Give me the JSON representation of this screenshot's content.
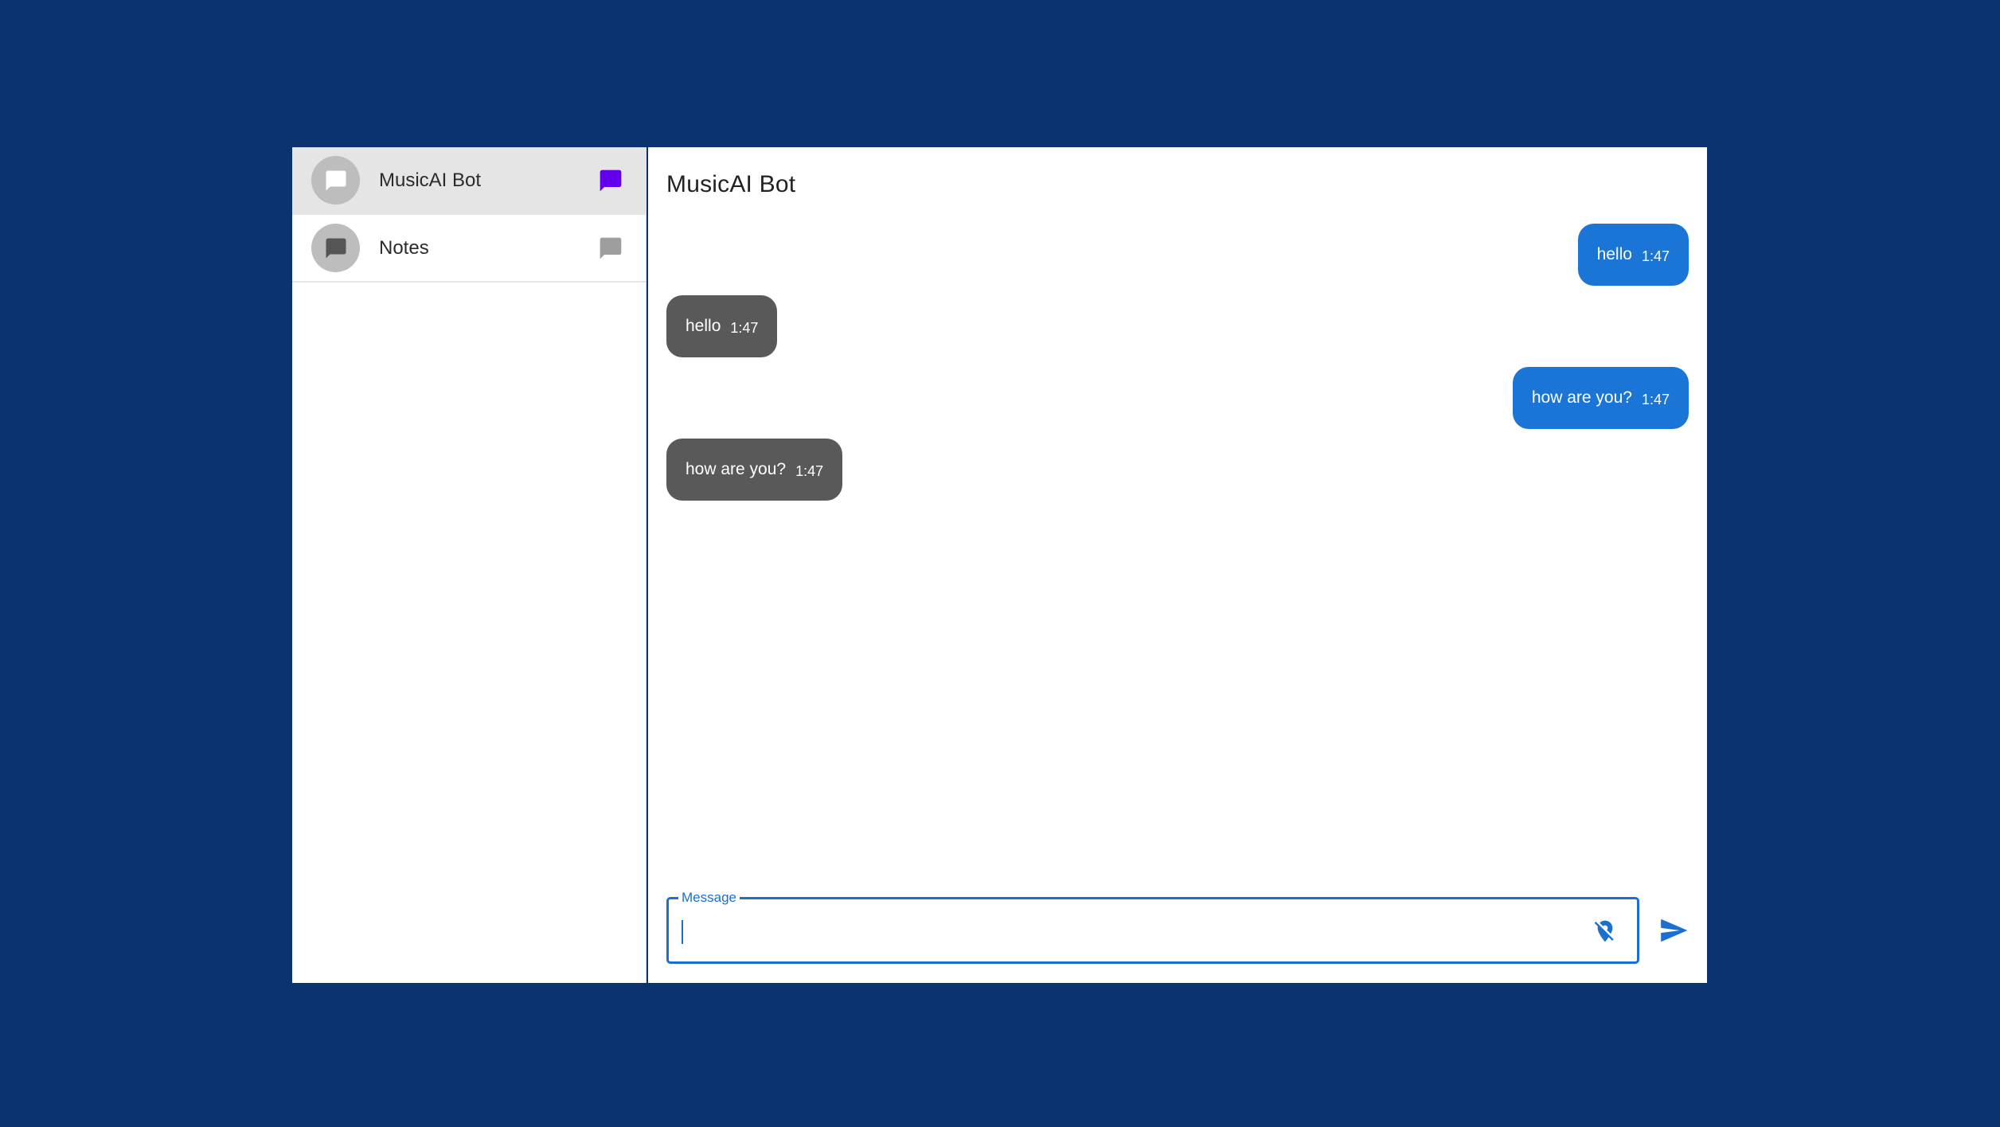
{
  "sidebar": {
    "conversations": [
      {
        "name": "MusicAI Bot",
        "active": true,
        "icon": "chat-bubble-icon",
        "trail_color": "#6200ee"
      },
      {
        "name": "Notes",
        "active": false,
        "icon": "chat-bubble-icon",
        "trail_color": "#9e9e9e"
      }
    ]
  },
  "chat": {
    "title": "MusicAI Bot",
    "messages": [
      {
        "direction": "out",
        "text": "hello",
        "time": "1:47"
      },
      {
        "direction": "in",
        "text": "hello",
        "time": "1:47"
      },
      {
        "direction": "out",
        "text": "how are you?",
        "time": "1:47"
      },
      {
        "direction": "in",
        "text": "how are you?",
        "time": "1:47"
      }
    ]
  },
  "composer": {
    "label": "Message",
    "value": "",
    "location_icon": "location-off-icon",
    "send_icon": "send-icon"
  },
  "colors": {
    "background": "#0b336f",
    "accent": "#1a75d6",
    "incoming_bubble": "#595959",
    "active_chat_icon": "#6200ee"
  }
}
